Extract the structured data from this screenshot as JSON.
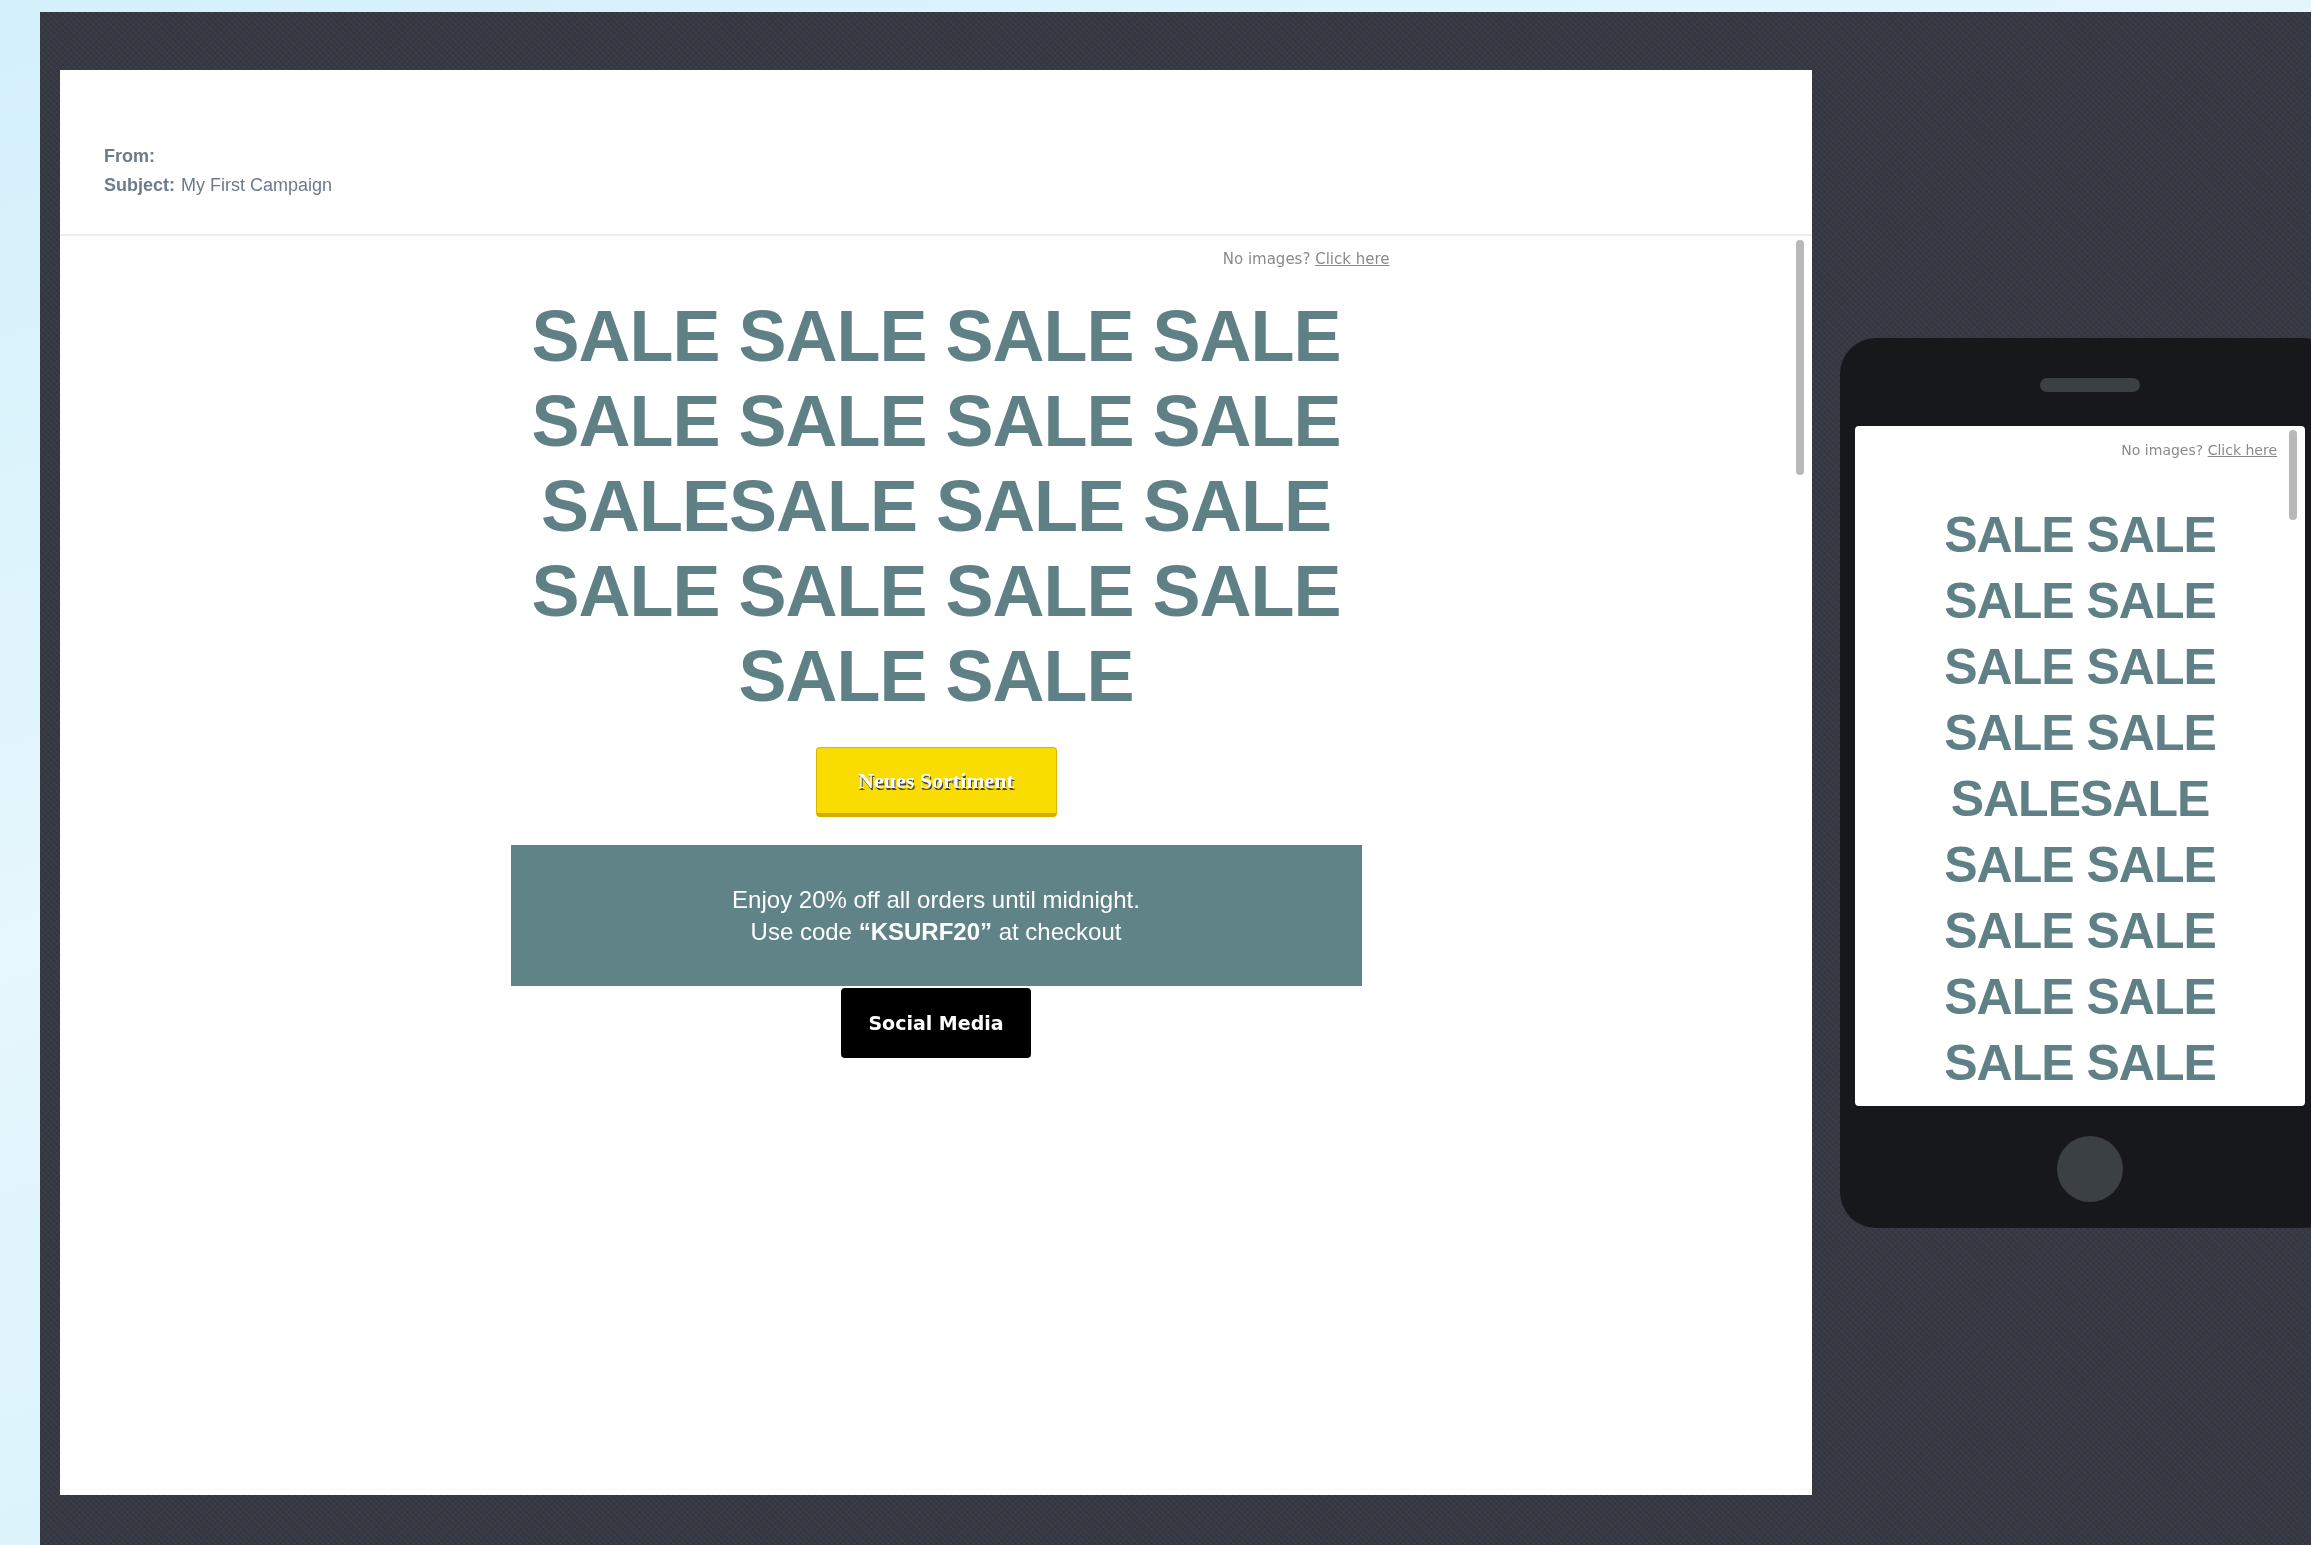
{
  "email_header": {
    "from_label": "From:",
    "subject_label": "Subject:",
    "subject": "My First Campaign"
  },
  "desktop_preview": {
    "no_images_text": "No images?",
    "no_images_link": "Click here",
    "headline_lines": [
      "SALE SALE SALE SALE",
      "SALE SALE SALE SALE",
      "SALESALE SALE SALE",
      "SALE SALE SALE SALE",
      "SALE SALE"
    ],
    "primary_button": "Neues Sortiment",
    "promo_lines": [
      "Enjoy 20% off all orders until midnight.",
      "Use code **“KSURF20”** at checkout"
    ],
    "secondary_button": "Social Media"
  },
  "mobile_preview": {
    "no_images_text": "No images?",
    "no_images_link": "Click here",
    "headline_lines": [
      "SALE SALE",
      "SALE SALE",
      "SALE SALE",
      "SALE SALE",
      "SALESALE",
      "SALE SALE",
      "SALE SALE",
      "SALE SALE",
      "SALE SALE"
    ]
  }
}
